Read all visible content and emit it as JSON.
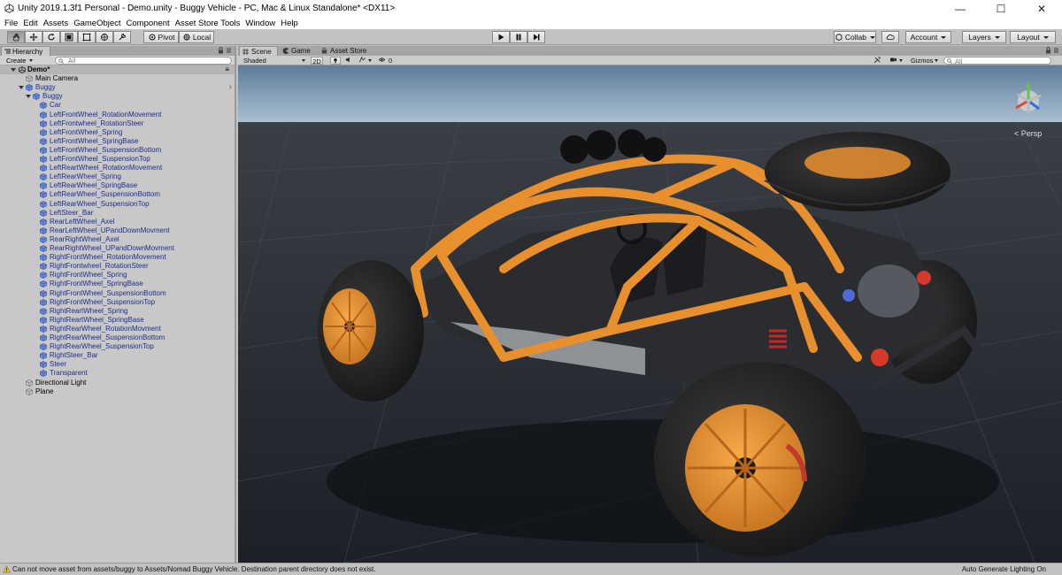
{
  "window": {
    "title": "Unity 2019.1.3f1 Personal - Demo.unity - Buggy Vehicle - PC, Mac & Linux Standalone* <DX11>",
    "minimize": "—",
    "maximize": "☐",
    "close": "✕"
  },
  "menu": [
    "File",
    "Edit",
    "Assets",
    "GameObject",
    "Component",
    "Asset Store Tools",
    "Window",
    "Help"
  ],
  "toolbar": {
    "pivot_label": "Pivot",
    "local_label": "Local",
    "collab_label": "Collab",
    "account_label": "Account",
    "layers_label": "Layers",
    "layout_label": "Layout"
  },
  "hierarchy": {
    "tab_label": "Hierarchy",
    "create_label": "Create",
    "search_placeholder": "All",
    "scene_name": "Demo*",
    "items": [
      {
        "label": "Main Camera",
        "depth": 1,
        "prefab": false,
        "expanded": null
      },
      {
        "label": "Buggy",
        "depth": 1,
        "prefab": true,
        "expanded": true
      },
      {
        "label": "Buggy",
        "depth": 2,
        "prefab": true,
        "expanded": true
      },
      {
        "label": "Car",
        "depth": 3,
        "prefab": true,
        "expanded": null
      },
      {
        "label": "LeftFrontWheel_RotationMovement",
        "depth": 3,
        "prefab": true,
        "expanded": null
      },
      {
        "label": "LeftFrontwheel_RotationSteer",
        "depth": 3,
        "prefab": true,
        "expanded": null
      },
      {
        "label": "LeftFrontWheel_Spring",
        "depth": 3,
        "prefab": true,
        "expanded": null
      },
      {
        "label": "LeftFrontWheel_SpringBase",
        "depth": 3,
        "prefab": true,
        "expanded": null
      },
      {
        "label": "LeftFrontWheel_SuspensionBottom",
        "depth": 3,
        "prefab": true,
        "expanded": null
      },
      {
        "label": "LeftFrontWheel_SuspensionTop",
        "depth": 3,
        "prefab": true,
        "expanded": null
      },
      {
        "label": "LeftReartWheel_RotationMovement",
        "depth": 3,
        "prefab": true,
        "expanded": null
      },
      {
        "label": "LeftRearWheel_Spring",
        "depth": 3,
        "prefab": true,
        "expanded": null
      },
      {
        "label": "LeftRearWheel_SpringBase",
        "depth": 3,
        "prefab": true,
        "expanded": null
      },
      {
        "label": "LeftRearWheel_SuspensionBottom",
        "depth": 3,
        "prefab": true,
        "expanded": null
      },
      {
        "label": "LeftRearWheel_SuspensionTop",
        "depth": 3,
        "prefab": true,
        "expanded": null
      },
      {
        "label": "LeftSteer_Bar",
        "depth": 3,
        "prefab": true,
        "expanded": null
      },
      {
        "label": "RearLeftWheel_Axel",
        "depth": 3,
        "prefab": true,
        "expanded": null
      },
      {
        "label": "RearLeftWheel_UPandDownMovment",
        "depth": 3,
        "prefab": true,
        "expanded": null
      },
      {
        "label": "RearRightWheel_Axel",
        "depth": 3,
        "prefab": true,
        "expanded": null
      },
      {
        "label": "RearRightWheel_UPandDownMovment",
        "depth": 3,
        "prefab": true,
        "expanded": null
      },
      {
        "label": "RightFrontWheel_RotationMovement",
        "depth": 3,
        "prefab": true,
        "expanded": null
      },
      {
        "label": "RightFrontwheel_RotationSteer",
        "depth": 3,
        "prefab": true,
        "expanded": null
      },
      {
        "label": "RightFrontWheel_Spring",
        "depth": 3,
        "prefab": true,
        "expanded": null
      },
      {
        "label": "RightFrontWheel_SpringBase",
        "depth": 3,
        "prefab": true,
        "expanded": null
      },
      {
        "label": "RightFrontWheel_SuspensionBottom",
        "depth": 3,
        "prefab": true,
        "expanded": null
      },
      {
        "label": "RightFrontWheel_SuspensionTop",
        "depth": 3,
        "prefab": true,
        "expanded": null
      },
      {
        "label": "RightReartWheel_Spring",
        "depth": 3,
        "prefab": true,
        "expanded": null
      },
      {
        "label": "RightReartWheel_SpringBase",
        "depth": 3,
        "prefab": true,
        "expanded": null
      },
      {
        "label": "RightRearWheel_RotationMovment",
        "depth": 3,
        "prefab": true,
        "expanded": null
      },
      {
        "label": "RightRearWheel_SuspensionBottom",
        "depth": 3,
        "prefab": true,
        "expanded": null
      },
      {
        "label": "RightRearWheel_SuspensionTop",
        "depth": 3,
        "prefab": true,
        "expanded": null
      },
      {
        "label": "RightSteer_Bar",
        "depth": 3,
        "prefab": true,
        "expanded": null
      },
      {
        "label": "Steer",
        "depth": 3,
        "prefab": true,
        "expanded": null
      },
      {
        "label": "Transparent",
        "depth": 3,
        "prefab": true,
        "expanded": null
      },
      {
        "label": "Directional Light",
        "depth": 1,
        "prefab": false,
        "expanded": null
      },
      {
        "label": "Plane",
        "depth": 1,
        "prefab": false,
        "expanded": null
      }
    ]
  },
  "scene": {
    "tabs": [
      {
        "label": "Scene",
        "icon": "scene-grid-icon",
        "active": true
      },
      {
        "label": "Game",
        "icon": "game-pacman-icon",
        "active": false
      },
      {
        "label": "Asset Store",
        "icon": "asset-store-bag-icon",
        "active": false
      }
    ],
    "shading_mode": "Shaded",
    "mode_2d": "2D",
    "hidden_count": "0",
    "gizmos_label": "Gizmos",
    "search_placeholder": "All",
    "persp_label": "< Persp",
    "colors": {
      "frame": "#e8902e",
      "rim": "#e8902e",
      "tire": "#1e1e1e",
      "sky": "#8fb0cc",
      "ground": "#2a2e34"
    }
  },
  "status": {
    "message": "Can not move asset from assets/buggy to Assets/Nomad Buggy Vehicle. Destination parent directory does not exist.",
    "right": "Auto Generate Lighting On"
  }
}
